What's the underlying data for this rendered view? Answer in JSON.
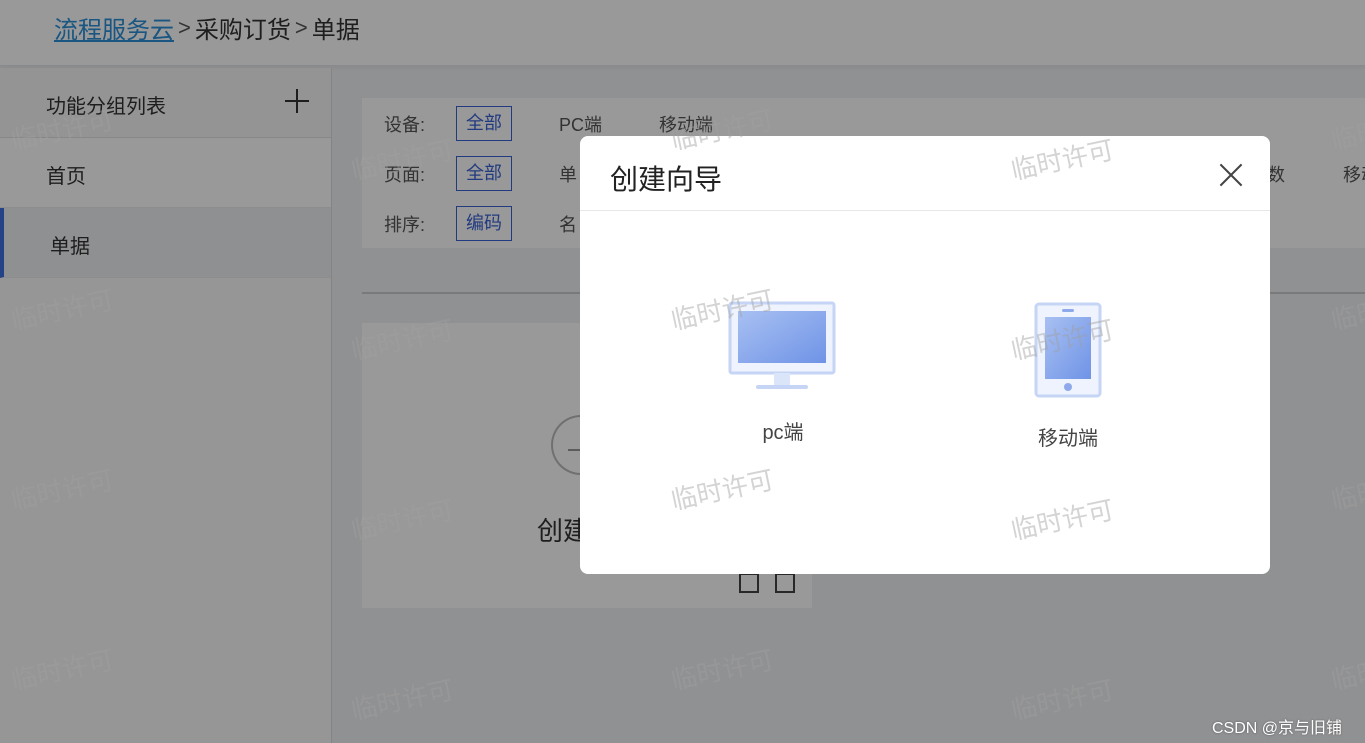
{
  "breadcrumb": {
    "root": "流程服务云",
    "sep": ">",
    "level2": "采购订货",
    "level3": "单据"
  },
  "sidebar": {
    "title": "功能分组列表",
    "add_icon": "plus-icon",
    "items": [
      {
        "label": "首页",
        "active": false
      },
      {
        "label": "单据",
        "active": true
      }
    ]
  },
  "filters": {
    "device": {
      "label": "设备:",
      "selected": "全部",
      "options": [
        "PC端",
        "移动端"
      ]
    },
    "page": {
      "label": "页面:",
      "selected": "全部",
      "options": [
        "单",
        "数",
        "移动"
      ]
    },
    "sort": {
      "label": "排序:",
      "selected": "编码",
      "options": [
        "名"
      ]
    }
  },
  "card": {
    "text": "创建"
  },
  "modal": {
    "title": "创建向导",
    "close_icon": "close-icon",
    "choices": [
      {
        "label": "pc端",
        "icon": "desktop-monitor-icon"
      },
      {
        "label": "移动端",
        "icon": "mobile-phone-icon"
      }
    ]
  },
  "watermark": {
    "text": "临时许可"
  },
  "credit": "CSDN @京与旧铺",
  "colors": {
    "accent": "#3a63d6",
    "link": "#2b8fd9",
    "active_bar": "#3d6fe0",
    "icon_blue": "#7a9ce8"
  }
}
